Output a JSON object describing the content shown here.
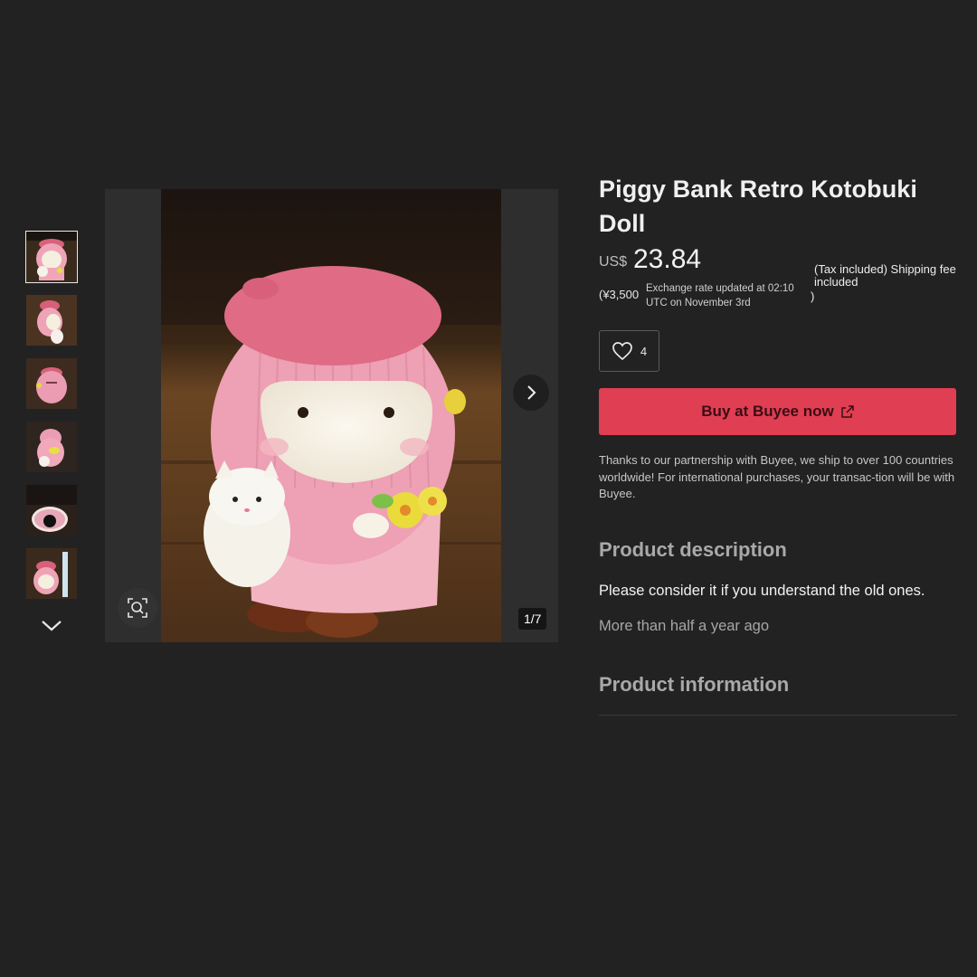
{
  "gallery": {
    "counter": "1/7",
    "thumbnails": [
      "thumb-1",
      "thumb-2",
      "thumb-3",
      "thumb-4",
      "thumb-5",
      "thumb-6"
    ],
    "selected_index": 0
  },
  "product": {
    "title": "Piggy Bank Retro Kotobuki Doll",
    "currency": "US$",
    "price": "23.84",
    "yen_price": "(¥3,500",
    "exchange_note": "Exchange rate updated at 02:10 UTC on November 3rd",
    "tax_note": "(Tax included) Shipping fee included",
    "tax_close": ")",
    "likes": "4",
    "buy_label": "Buy at Buyee now",
    "shipping_note": "Thanks to our partnership with Buyee, we ship to over 100 countries worldwide! For international purchases, your transac-tion will be with Buyee."
  },
  "description": {
    "heading": "Product description",
    "text": "Please consider it if you understand the old ones.",
    "posted": "More than half a year ago"
  },
  "information": {
    "heading": "Product information"
  },
  "colors": {
    "background": "#222223",
    "buy_button": "#e03e52",
    "gallery_bg": "#2e2e2f"
  }
}
